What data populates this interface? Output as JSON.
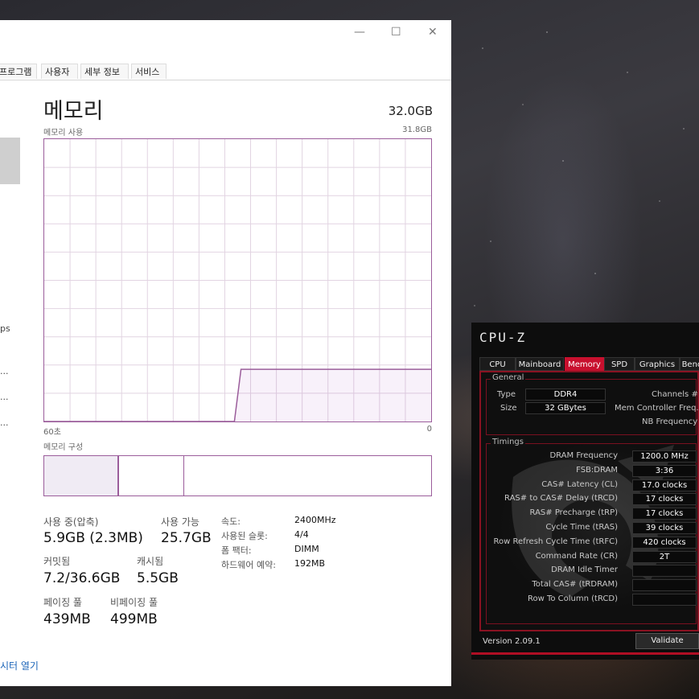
{
  "task_manager": {
    "window_controls": {
      "minimize": "—",
      "maximize": "☐",
      "close": "✕"
    },
    "tabs": [
      "프로그램",
      "사용자",
      "세부 정보",
      "서비스"
    ],
    "sidebar_fragments": [
      "ps",
      "...",
      "...",
      "..."
    ],
    "title": "메모리",
    "total": "32.0GB",
    "graph_label": "메모리 사용",
    "graph_max": "31.8GB",
    "graph_left_time": "60초",
    "graph_right_time": "0",
    "usage_chart": {
      "type": "area",
      "x_label_left": "60초",
      "x_label_right": "0",
      "y_max_gb": 31.8,
      "points_pct": [
        0,
        0,
        0,
        0,
        0,
        0,
        0,
        0,
        0,
        0,
        0,
        0,
        0,
        0,
        0,
        0,
        0,
        0,
        0,
        0,
        0,
        0,
        0,
        0,
        0,
        0,
        0,
        0,
        0,
        0,
        18.5,
        18.5,
        18.5,
        18.5,
        18.5,
        18.5,
        18.5,
        18.5,
        18.5,
        18.5,
        18.5,
        18.5,
        18.5,
        18.5,
        18.5,
        18.5,
        18.5,
        18.5,
        18.5,
        18.5,
        18.5,
        18.5,
        18.5,
        18.5,
        18.5,
        18.5,
        18.5,
        18.5,
        18.5,
        18.5
      ]
    },
    "composition_label": "메모리 구성",
    "stats": {
      "in_use_label": "사용 중(압축)",
      "in_use_value": "5.9GB (2.3MB)",
      "available_label": "사용 가능",
      "available_value": "25.7GB",
      "committed_label": "커밋됨",
      "committed_value": "7.2/36.6GB",
      "cached_label": "캐시됨",
      "cached_value": "5.5GB",
      "paged_label": "페이징 풀",
      "paged_value": "439MB",
      "nonpaged_label": "비페이징 풀",
      "nonpaged_value": "499MB"
    },
    "details": [
      {
        "label": "속도:",
        "value": "2400MHz"
      },
      {
        "label": "사용된 슬롯:",
        "value": "4/4"
      },
      {
        "label": "폼 팩터:",
        "value": "DIMM"
      },
      {
        "label": "하드웨어 예약:",
        "value": "192MB"
      }
    ],
    "open_link": "시터 열기"
  },
  "cpuz": {
    "logo": "CPU-Z",
    "tabs": [
      "CPU",
      "Mainboard",
      "Memory",
      "SPD",
      "Graphics",
      "Benc"
    ],
    "active_tab": "Memory",
    "general_title": "General",
    "type_label": "Type",
    "type_value": "DDR4",
    "size_label": "Size",
    "size_value": "32 GBytes",
    "channels_label": "Channels #",
    "mem_ctrl_label": "Mem Controller Freq.",
    "nb_freq_label": "NB Frequency",
    "timings_title": "Timings",
    "timings": [
      {
        "label": "DRAM Frequency",
        "value": "1200.0 MHz"
      },
      {
        "label": "FSB:DRAM",
        "value": "3:36"
      },
      {
        "label": "CAS# Latency (CL)",
        "value": "17.0 clocks"
      },
      {
        "label": "RAS# to CAS# Delay (tRCD)",
        "value": "17 clocks"
      },
      {
        "label": "RAS# Precharge (tRP)",
        "value": "17 clocks"
      },
      {
        "label": "Cycle Time (tRAS)",
        "value": "39 clocks"
      },
      {
        "label": "Row Refresh Cycle Time (tRFC)",
        "value": "420 clocks"
      },
      {
        "label": "Command Rate (CR)",
        "value": "2T"
      },
      {
        "label": "DRAM Idle Timer",
        "value": ""
      },
      {
        "label": "Total CAS# (tRDRAM)",
        "value": ""
      },
      {
        "label": "Row To Column (tRCD)",
        "value": ""
      }
    ],
    "version": "Version 2.09.1",
    "validate": "Validate",
    "accent": "#c8102e"
  }
}
